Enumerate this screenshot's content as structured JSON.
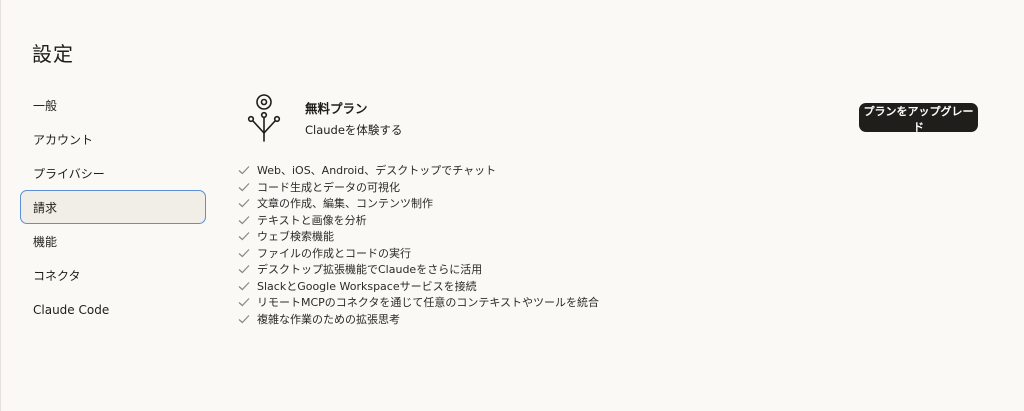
{
  "page": {
    "title": "設定"
  },
  "sidebar": {
    "items": [
      {
        "label": "一般"
      },
      {
        "label": "アカウント"
      },
      {
        "label": "プライバシー"
      },
      {
        "label": "請求"
      },
      {
        "label": "機能"
      },
      {
        "label": "コネクタ"
      },
      {
        "label": "Claude Code"
      }
    ],
    "active_index": 3
  },
  "plan": {
    "name": "無料プラン",
    "tagline": "Claudeを体験する",
    "icon": "sprout-icon",
    "upgrade_label": "プランをアップグレード"
  },
  "features": [
    "Web、iOS、Android、デスクトップでチャット",
    "コード生成とデータの可視化",
    "文章の作成、編集、コンテンツ制作",
    "テキストと画像を分析",
    "ウェブ検索機能",
    "ファイルの作成とコードの実行",
    "デスクトップ拡張機能でClaudeをさらに活用",
    "SlackとGoogle Workspaceサービスを接続",
    "リモートMCPのコネクタを通じて任意のコンテキストやツールを統合",
    "複雑な作業のための拡張思考"
  ],
  "colors": {
    "background": "#faf9f6",
    "active_item_bg": "#f0eee6",
    "active_item_border": "#5b8fd6",
    "button_bg": "#1f1e1b",
    "check": "#8a8780"
  }
}
